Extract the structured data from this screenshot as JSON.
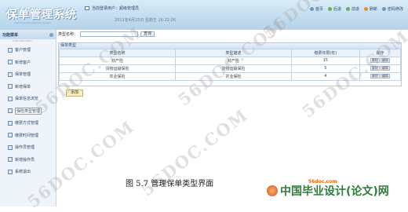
{
  "header": {
    "app_title": "保单管理系统",
    "subtitle": "Insurance Management System",
    "breadcrumb": "当前登录用户：超级管理员",
    "datetime": "2011年4月15日 星期五 16:22:06",
    "toolbar": {
      "home": "首页",
      "back": "后退",
      "forward": "前进",
      "refresh": "刷新",
      "password": "密码修改"
    }
  },
  "sidebar": {
    "title": "功能菜单",
    "sub": "FUNCTION MENU",
    "items": [
      {
        "label": "客户管理"
      },
      {
        "label": "新增客户"
      },
      {
        "label": "保单管理"
      },
      {
        "label": "新增保单"
      },
      {
        "label": "保单信息浏览"
      },
      {
        "label": "保险类型管理"
      },
      {
        "label": "缴费方式管理"
      },
      {
        "label": "缴费时间管理"
      },
      {
        "label": "操作员管理"
      },
      {
        "label": "新增操作员"
      },
      {
        "label": "系统退出"
      }
    ]
  },
  "search": {
    "label": "类型名称：",
    "value": "",
    "button": "查询"
  },
  "panel": {
    "title": "保单类型",
    "columns": [
      "类型名称",
      "类型描述",
      "缴费年限(年)",
      "操作"
    ],
    "rows": [
      {
        "name": "财产险",
        "desc": "财产险",
        "years": "15"
      },
      {
        "name": "货物运输保险",
        "desc": "货物运输保险",
        "years": "5"
      },
      {
        "name": "农业保险",
        "desc": "农业保险",
        "years": "4"
      }
    ],
    "delete_label": "删除",
    "edit_label": "编辑"
  },
  "add_button": "添加",
  "caption": "图 5.7 管理保单类型界面",
  "watermark": "56DOC.COM",
  "logo": {
    "url": "56doc.com",
    "text": "中国毕业设计(论文)网"
  }
}
